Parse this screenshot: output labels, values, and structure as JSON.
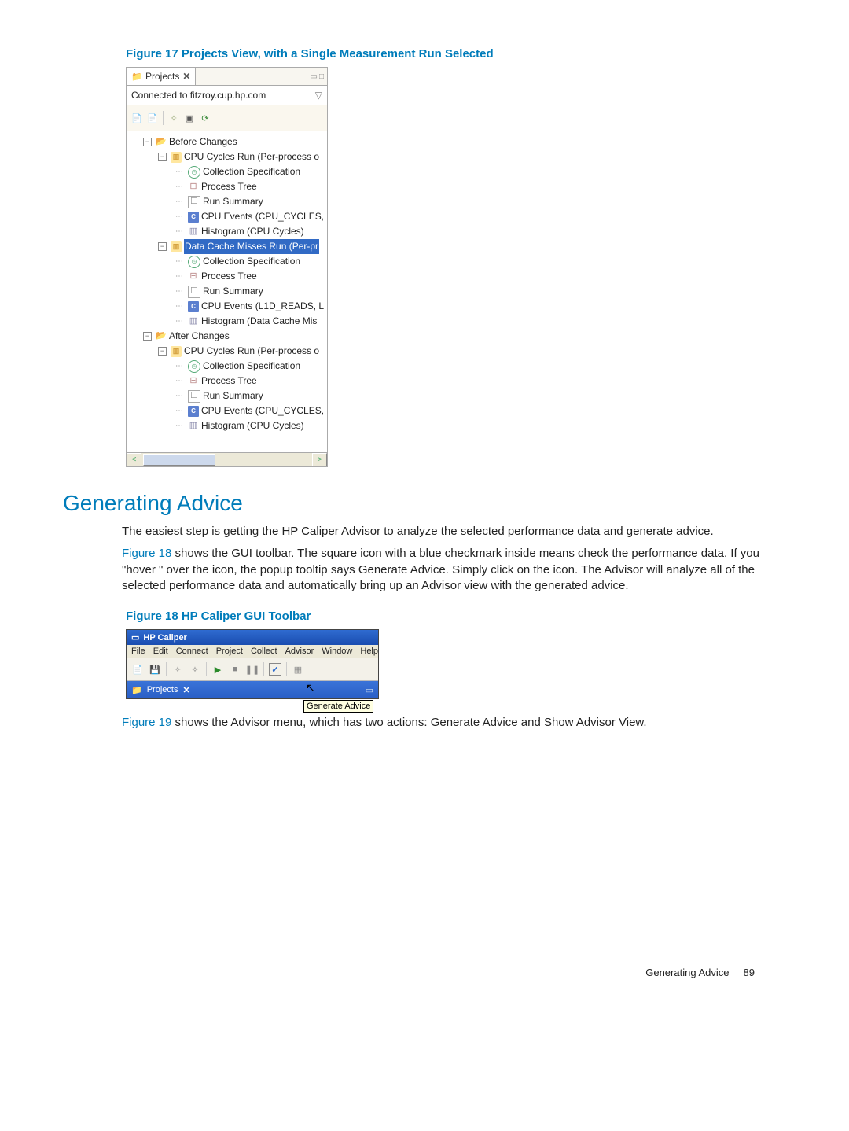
{
  "fig17_caption": "Figure 17 Projects View, with a Single Measurement Run Selected",
  "panel": {
    "tab_label": "Projects",
    "conn_status": "Connected to fitzroy.cup.hp.com"
  },
  "tree": {
    "before": {
      "label": "Before Changes",
      "cpu_run": {
        "label": "CPU Cycles Run (Per-process o",
        "children": [
          "Collection Specification",
          "Process Tree",
          "Run Summary",
          "CPU Events (CPU_CYCLES,",
          "Histogram (CPU Cycles)"
        ]
      },
      "dcache_run": {
        "label": "Data Cache Misses Run (Per-pr",
        "children": [
          "Collection Specification",
          "Process Tree",
          "Run Summary",
          "CPU Events (L1D_READS, L",
          "Histogram (Data Cache Mis"
        ]
      }
    },
    "after": {
      "label": "After Changes",
      "cpu_run": {
        "label": "CPU Cycles Run (Per-process o",
        "children": [
          "Collection Specification",
          "Process Tree",
          "Run Summary",
          "CPU Events (CPU_CYCLES,",
          "Histogram (CPU Cycles)"
        ]
      }
    }
  },
  "section_heading": "Generating Advice",
  "para1": "The easiest step is getting the HP Caliper Advisor to analyze the selected performance data and generate advice.",
  "para2a": "Figure 18",
  "para2b": " shows the GUI toolbar. The square icon with a blue checkmark inside means check the performance data. If you \"hover \" over the icon, the popup tooltip says Generate Advice. Simply click on the icon. The Advisor will analyze all of the selected performance data and automatically bring up an Advisor view with the generated advice.",
  "fig18_caption": "Figure 18 HP Caliper GUI Toolbar",
  "caliper": {
    "title": "HP Caliper",
    "menu": [
      "File",
      "Edit",
      "Connect",
      "Project",
      "Collect",
      "Advisor",
      "Window",
      "Help"
    ],
    "tab_label": "Projects",
    "tooltip": "Generate Advice"
  },
  "para3a": "Figure 19",
  "para3b": " shows the Advisor menu, which has two actions: Generate Advice and Show Advisor View.",
  "footer_label": "Generating Advice",
  "footer_page": "89"
}
